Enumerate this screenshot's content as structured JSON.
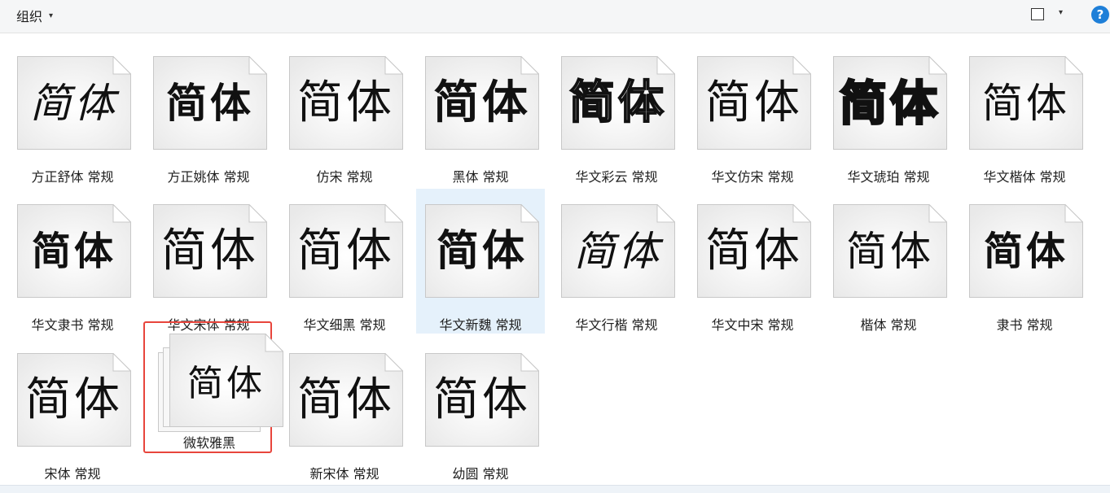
{
  "toolbar": {
    "organize_label": "组织",
    "caret": "▾",
    "help_label": "?"
  },
  "font_items": [
    {
      "preview": "简体",
      "label": "方正舒体 常规",
      "style": "brush"
    },
    {
      "preview": "简体",
      "label": "方正姚体 常规",
      "style": "bold-narrow"
    },
    {
      "preview": "简体",
      "label": "仿宋 常规",
      "style": "thin"
    },
    {
      "preview": "简体",
      "label": "黑体 常规",
      "style": "bold"
    },
    {
      "preview": "简体",
      "label": "华文彩云 常规",
      "style": "outline"
    },
    {
      "preview": "简体",
      "label": "华文仿宋 常规",
      "style": "thin"
    },
    {
      "preview": "简体",
      "label": "华文琥珀 常规",
      "style": "heavy"
    },
    {
      "preview": "简体",
      "label": "华文楷体 常规",
      "style": "kai"
    },
    {
      "preview": "简体",
      "label": "华文隶书 常规",
      "style": "li"
    },
    {
      "preview": "简体",
      "label": "华文宋体 常规",
      "style": "thin"
    },
    {
      "preview": "简体",
      "label": "华文细黑 常规",
      "style": "regular"
    },
    {
      "preview": "简体",
      "label": "华文新魏 常规",
      "style": "wei"
    },
    {
      "preview": "简体",
      "label": "华文行楷 常规",
      "style": "brush"
    },
    {
      "preview": "简体",
      "label": "华文中宋 常规",
      "style": "regular"
    },
    {
      "preview": "简体",
      "label": "楷体 常规",
      "style": "kai"
    },
    {
      "preview": "简体",
      "label": "隶书 常规",
      "style": "li"
    },
    {
      "preview": "简体",
      "label": "宋体 常规",
      "style": "thin"
    },
    {
      "preview": "简体",
      "label": "微软雅黑",
      "style": "regular"
    },
    {
      "preview": "简体",
      "label": "新宋体 常规",
      "style": "thin"
    },
    {
      "preview": "简体",
      "label": "幼圆 常规",
      "style": "thin"
    }
  ],
  "selected_item": "华文新魏 常规",
  "highlighted_item": "微软雅黑",
  "colors": {
    "accent": "#1e7fd8",
    "selection": "#e5f1fb",
    "highlight_border": "#e8453c"
  }
}
